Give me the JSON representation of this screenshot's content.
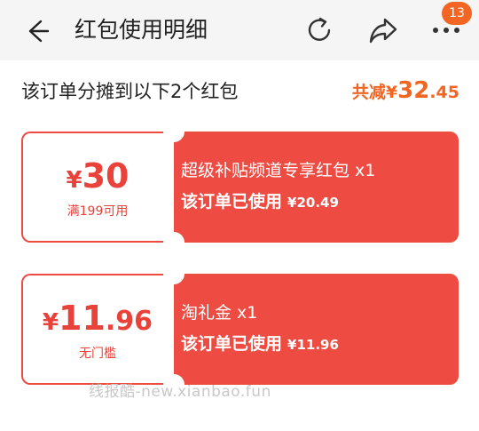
{
  "header": {
    "title": "红包使用明细",
    "notification_count": "13"
  },
  "summary": {
    "text": "该订单分摊到以下2个红包",
    "total_label": "共减",
    "total_currency": "¥",
    "total_int": "32",
    "total_dec": ".45"
  },
  "coupons": [
    {
      "currency": "¥",
      "amount_int": "30",
      "amount_dec": "",
      "condition": "满199可用",
      "name": "超级补贴频道专享红包 x1",
      "used_label": "该订单已使用",
      "used_amount": "¥20.49"
    },
    {
      "currency": "¥",
      "amount_int": "11",
      "amount_dec": ".96",
      "condition": "无门槛",
      "name": "淘礼金 x1",
      "used_label": "该订单已使用",
      "used_amount": "¥11.96"
    }
  ],
  "watermark": "线报酷-new.xianbao.fun",
  "colors": {
    "accent": "#f26522",
    "card_red": "#ee4b43",
    "amount_red": "#e8423a"
  },
  "icons": [
    "back-arrow-icon",
    "refresh-icon",
    "share-icon",
    "more-icon"
  ]
}
